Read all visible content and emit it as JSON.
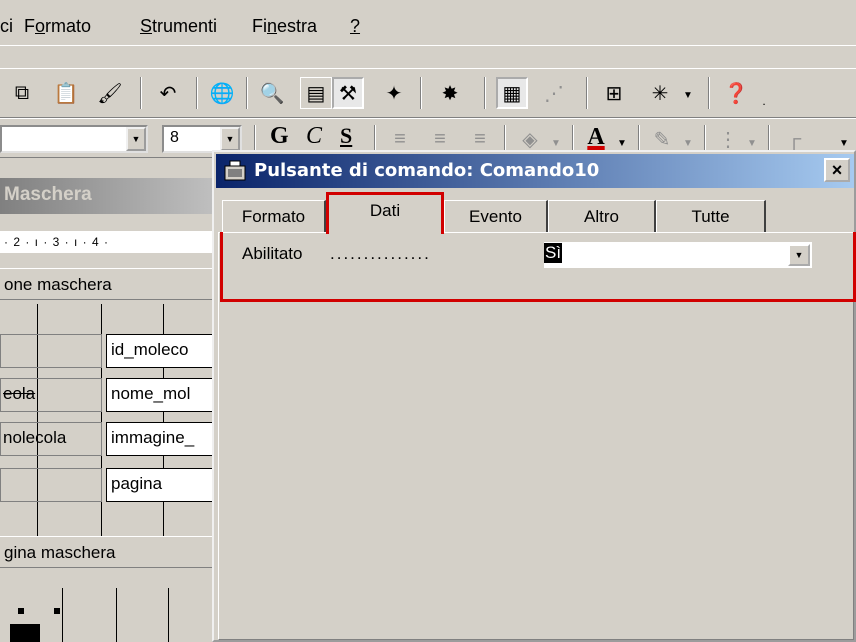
{
  "menubar": {
    "items": [
      {
        "label": "ci",
        "underline": ""
      },
      {
        "label": "Formato",
        "underline": "o"
      },
      {
        "label": "Strumenti",
        "underline": "S"
      },
      {
        "label": "Finestra",
        "underline": "n"
      },
      {
        "label": "?",
        "underline": "?"
      }
    ]
  },
  "toolbar_format": {
    "font_size": "8",
    "bold": "G",
    "italic": "C",
    "underline": "S"
  },
  "designer": {
    "title": "Maschera",
    "ruler": "· 2 · ı · 3 · ı · 4 ·",
    "header_section": "one maschera",
    "footer_section": "gina maschera",
    "fields": [
      {
        "label": "",
        "value": "id_moleco"
      },
      {
        "label": "eola",
        "value": "nome_mol"
      },
      {
        "label": "nolecola",
        "value": "immagine_"
      },
      {
        "label": "",
        "value": "pagina"
      }
    ]
  },
  "property_sheet": {
    "title": "Pulsante di comando: Comando10",
    "close": "×",
    "tabs": [
      "Formato",
      "Dati",
      "Evento",
      "Altro",
      "Tutte"
    ],
    "active_tab": "Dati",
    "property": {
      "name": "Abilitato",
      "dots": "...............",
      "value": "Sì"
    }
  },
  "colors": {
    "highlight_red": "#d10000",
    "title_blue": "#0a246a"
  }
}
